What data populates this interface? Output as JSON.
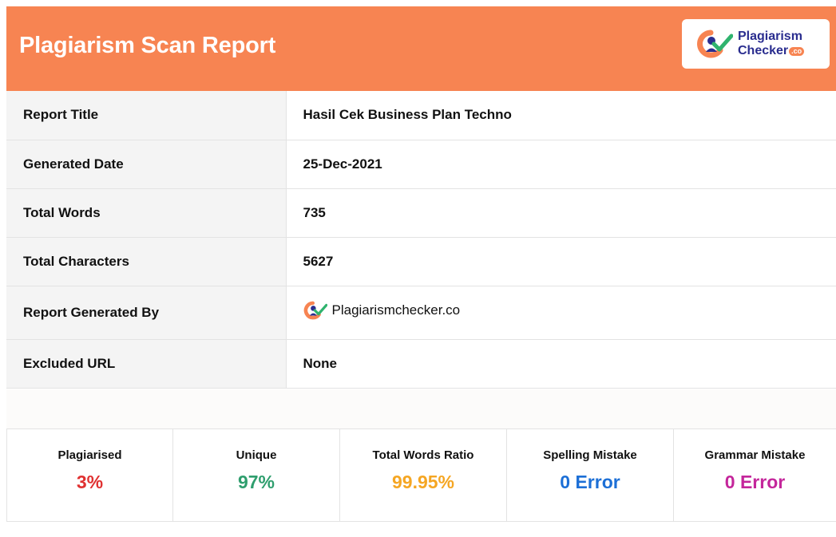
{
  "header": {
    "title": "Plagiarism Scan Report",
    "logo": {
      "line1": "Plagiarism",
      "line2": "Checker",
      "badge": ".co"
    }
  },
  "info": {
    "rows": [
      {
        "label": "Report Title",
        "value": "Hasil Cek Business Plan Techno"
      },
      {
        "label": "Generated Date",
        "value": "25-Dec-2021"
      },
      {
        "label": "Total Words",
        "value": "735"
      },
      {
        "label": "Total Characters",
        "value": "5627"
      },
      {
        "label": "Report Generated By",
        "value": "Plagiarismchecker.co"
      },
      {
        "label": "Excluded URL",
        "value": "None"
      }
    ]
  },
  "stats": [
    {
      "label": "Plagiarised",
      "value": "3%",
      "color": "#e03131"
    },
    {
      "label": "Unique",
      "value": "97%",
      "color": "#2f9e6e"
    },
    {
      "label": "Total Words Ratio",
      "value": "99.95%",
      "color": "#f5a623"
    },
    {
      "label": "Spelling Mistake",
      "value": "0 Error",
      "color": "#1c6fd6"
    },
    {
      "label": "Grammar Mistake",
      "value": "0 Error",
      "color": "#c4269b"
    }
  ],
  "colors": {
    "accent": "#f78452",
    "brand": "#2a2d8f"
  },
  "icons": {
    "logo": "plagiarism-checker-logo-icon"
  }
}
